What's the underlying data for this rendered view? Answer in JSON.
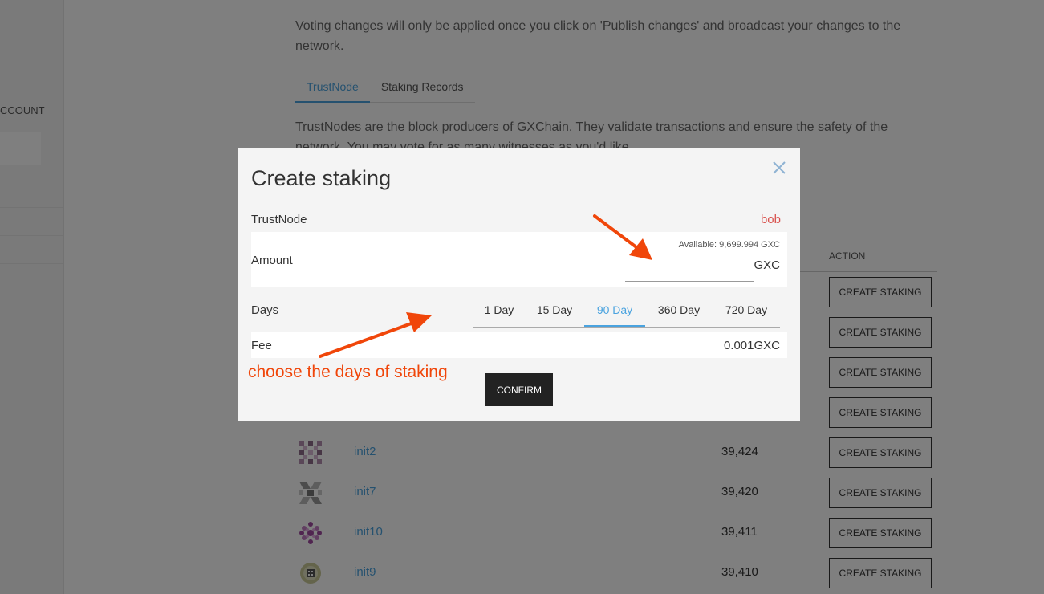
{
  "sidebar": {
    "account_label": "CCOUNT"
  },
  "page": {
    "intro": "Voting changes will only be applied once you click on 'Publish changes' and broadcast your changes to the network.",
    "tabs": [
      {
        "label": "TrustNode",
        "active": true
      },
      {
        "label": "Staking Records",
        "active": false
      }
    ],
    "description": "TrustNodes are the block producers of GXChain. They validate transactions and ensure the safety of the network. You may vote for as many witnesses as you'd like.",
    "table": {
      "action_header": "ACTION",
      "rows": [
        {
          "name": "",
          "votes": "",
          "action": "CREATE STAKING"
        },
        {
          "name": "",
          "votes": "",
          "action": "CREATE STAKING"
        },
        {
          "name": "",
          "votes": "",
          "action": "CREATE STAKING"
        },
        {
          "name": "",
          "votes": "",
          "action": "CREATE STAKING"
        },
        {
          "name": "init2",
          "votes": "39,424",
          "action": "CREATE STAKING"
        },
        {
          "name": "init7",
          "votes": "39,420",
          "action": "CREATE STAKING"
        },
        {
          "name": "init10",
          "votes": "39,411",
          "action": "CREATE STAKING"
        },
        {
          "name": "init9",
          "votes": "39,410",
          "action": "CREATE STAKING"
        }
      ]
    }
  },
  "modal": {
    "title": "Create staking",
    "close_icon": "close-icon",
    "trustnode_label": "TrustNode",
    "trustnode_value": "bob",
    "amount_label": "Amount",
    "available": "Available: 9,699.994 GXC",
    "amount_value": "",
    "amount_unit": "GXC",
    "days_label": "Days",
    "days": [
      {
        "label": "1 Day",
        "active": false
      },
      {
        "label": "15 Day",
        "active": false
      },
      {
        "label": "90 Day",
        "active": true
      },
      {
        "label": "360 Day",
        "active": false
      },
      {
        "label": "720 Day",
        "active": false
      }
    ],
    "fee_label": "Fee",
    "fee_value": "0.001GXC",
    "confirm_label": "CONFIRM"
  },
  "annotation": {
    "text": "choose the days of staking",
    "color": "#f0460a"
  },
  "colors": {
    "accent": "#4aa3df",
    "danger": "#d9534f",
    "annotation": "#f0460a",
    "button_dark": "#222222"
  }
}
